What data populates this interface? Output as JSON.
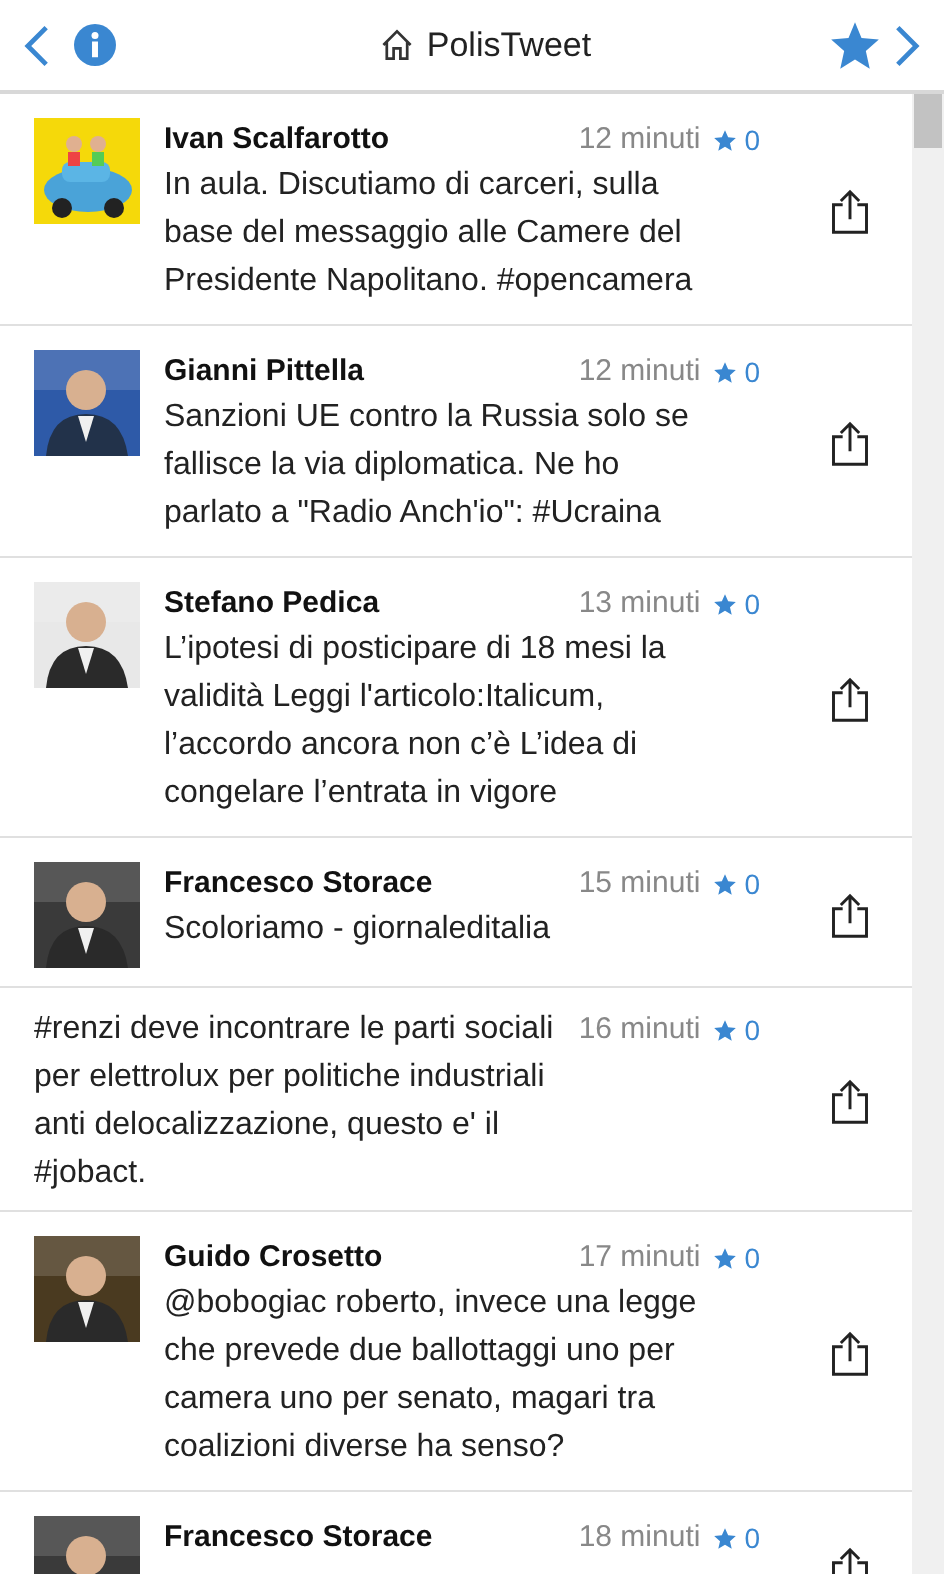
{
  "header": {
    "title": "PolisTweet"
  },
  "tweets": [
    {
      "kind": "avatar",
      "author": "Ivan Scalfarotto",
      "time": "12 minuti",
      "likes": "0",
      "text": "In aula. Discutiamo di carceri, sulla base del messaggio alle Camere del Presidente Napolitano. #opencamera"
    },
    {
      "kind": "avatar",
      "author": "Gianni Pittella",
      "time": "12 minuti",
      "likes": "0",
      "text": "Sanzioni UE contro la Russia solo se fallisce la via diplomatica. Ne ho parlato a \"Radio Anch'io\": #Ucraina"
    },
    {
      "kind": "avatar",
      "author": "Stefano Pedica",
      "time": "13 minuti",
      "likes": "0",
      "text": "L’ipotesi di posticipare di 18 mesi la validità Leggi l'articolo:Italicum, l’accordo ancora non c’è L’idea di congelare l’entrata in vigore"
    },
    {
      "kind": "avatar",
      "author": "Francesco Storace",
      "time": "15 minuti",
      "likes": "0",
      "text": "Scoloriamo - giornaleditalia"
    },
    {
      "kind": "plain",
      "time": "16 minuti",
      "likes": "0",
      "text": "#renzi deve incontrare le parti sociali per elettrolux per politiche industriali anti delocalizzazione, questo e' il #jobact."
    },
    {
      "kind": "avatar",
      "author": "Guido Crosetto",
      "time": "17 minuti",
      "likes": "0",
      "text": "@bobogiac roberto, invece una legge che prevede due ballottaggi uno per camera uno per senato, magari tra coalizioni diverse ha senso?"
    },
    {
      "kind": "avatar",
      "author": "Francesco Storace",
      "time": "18 minuti",
      "likes": "0"
    }
  ]
}
